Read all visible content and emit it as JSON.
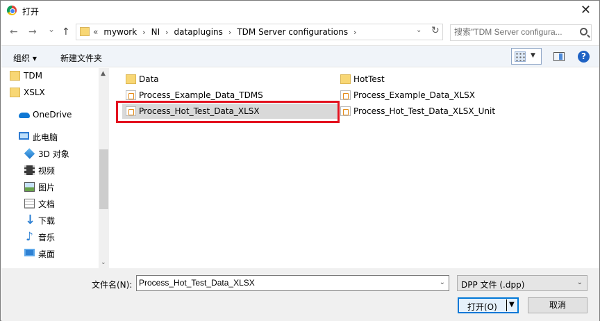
{
  "title": "打开",
  "nav": {
    "back": "←",
    "forward": "→",
    "recent": "⌄",
    "up": "↑",
    "breadcrumb_prefix": "«",
    "breadcrumbs": [
      "mywork",
      "NI",
      "dataplugins",
      "TDM Server configurations"
    ],
    "breadcrumb_sep": "›",
    "search_placeholder": "搜索\"TDM Server configura..."
  },
  "toolbar": {
    "organize": "组织 ▾",
    "new_folder": "新建文件夹"
  },
  "sidebar": {
    "items": [
      {
        "label": "TDM",
        "icon": "folder-icon"
      },
      {
        "label": "XSLX",
        "icon": "folder-icon"
      },
      {
        "label": "OneDrive",
        "icon": "onedrive-icon"
      },
      {
        "label": "此电脑",
        "icon": "computer-icon"
      },
      {
        "label": "3D 对象",
        "icon": "3d-objects-icon"
      },
      {
        "label": "视频",
        "icon": "video-icon"
      },
      {
        "label": "图片",
        "icon": "pictures-icon"
      },
      {
        "label": "文档",
        "icon": "documents-icon"
      },
      {
        "label": "下载",
        "icon": "downloads-icon"
      },
      {
        "label": "音乐",
        "icon": "music-icon"
      },
      {
        "label": "桌面",
        "icon": "desktop-icon"
      }
    ]
  },
  "files": [
    {
      "name": "Data",
      "type": "folder"
    },
    {
      "name": "HotTest",
      "type": "folder"
    },
    {
      "name": "Process_Example_Data_TDMS",
      "type": "file"
    },
    {
      "name": "Process_Example_Data_XLSX",
      "type": "file"
    },
    {
      "name": "Process_Hot_Test_Data_XLSX",
      "type": "file",
      "selected": true
    },
    {
      "name": "Process_Hot_Test_Data_XLSX_Unit",
      "type": "file"
    }
  ],
  "bottom": {
    "filename_label": "文件名(N):",
    "filename_value": "Process_Hot_Test_Data_XLSX",
    "filetype_value": "DPP 文件 (.dpp)",
    "open_label": "打开(O)",
    "cancel_label": "取消"
  },
  "colors": {
    "highlight": "#e3121f",
    "accent": "#0078d7",
    "toolbar_bg": "#f0f4f9"
  }
}
